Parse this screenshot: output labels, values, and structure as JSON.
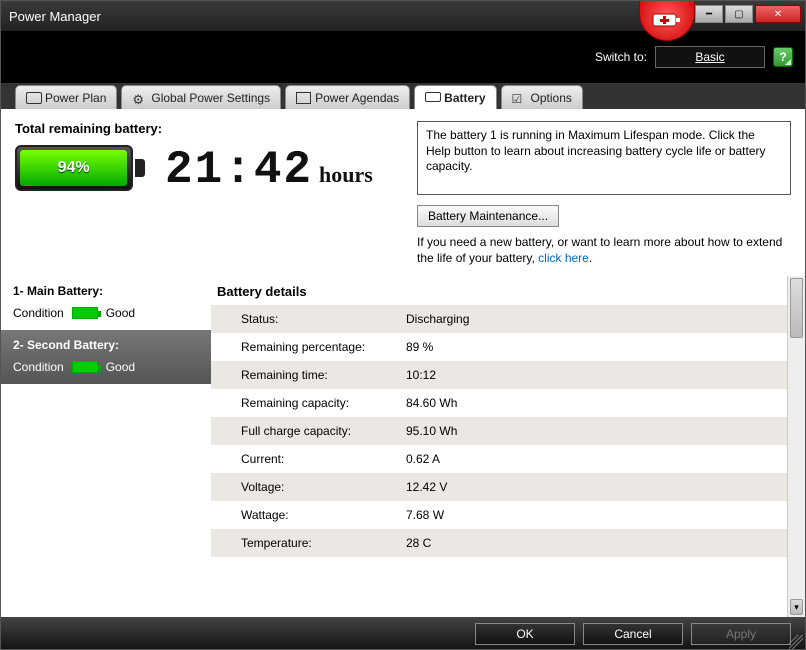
{
  "window": {
    "title": "Power Manager"
  },
  "switch": {
    "label": "Switch to:",
    "button": "Basic"
  },
  "tabs": {
    "plan": "Power Plan",
    "global": "Global Power Settings",
    "agendas": "Power Agendas",
    "battery": "Battery",
    "options": "Options"
  },
  "overview": {
    "heading": "Total remaining battery:",
    "percent": "94%",
    "time": "21:42",
    "time_unit": "hours",
    "info": "The battery 1 is running in Maximum Lifespan mode. Click the Help button to learn about increasing battery cycle life or battery capacity.",
    "maintenance_btn": "Battery Maintenance...",
    "hint_prefix": "If you need a new battery, or want to learn more about how to extend the life of your battery, ",
    "hint_link": "click here",
    "hint_suffix": "."
  },
  "sidebar": {
    "items": [
      {
        "title": "1- Main Battery:",
        "cond_label": "Condition",
        "cond_value": "Good"
      },
      {
        "title": "2- Second Battery:",
        "cond_label": "Condition",
        "cond_value": "Good"
      }
    ]
  },
  "details": {
    "heading": "Battery details",
    "rows": [
      {
        "k": "Status:",
        "v": "Discharging"
      },
      {
        "k": "Remaining percentage:",
        "v": "89 %"
      },
      {
        "k": "Remaining time:",
        "v": "10:12"
      },
      {
        "k": "Remaining capacity:",
        "v": "84.60 Wh"
      },
      {
        "k": "Full charge capacity:",
        "v": "95.10 Wh"
      },
      {
        "k": "Current:",
        "v": "0.62 A"
      },
      {
        "k": "Voltage:",
        "v": "12.42 V"
      },
      {
        "k": "Wattage:",
        "v": "7.68 W"
      },
      {
        "k": "Temperature:",
        "v": "28 C"
      }
    ]
  },
  "footer": {
    "ok": "OK",
    "cancel": "Cancel",
    "apply": "Apply"
  }
}
